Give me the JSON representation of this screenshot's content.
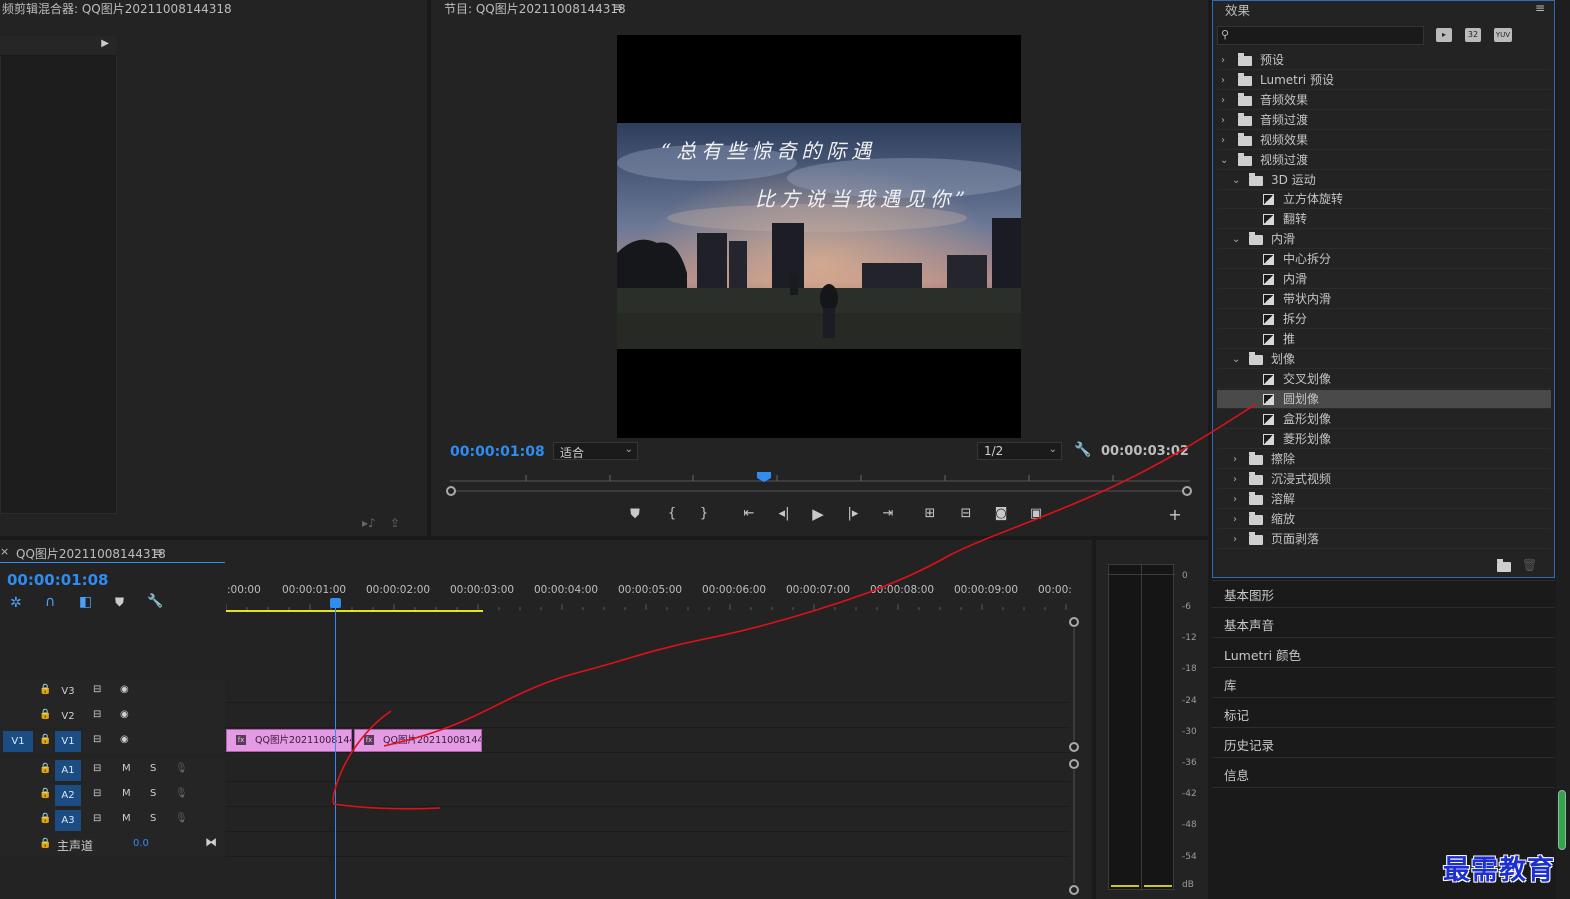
{
  "source_mixer": {
    "title": "频剪辑混合器: QQ图片20211008144318"
  },
  "program": {
    "title": "节目: QQ图片20211008144318",
    "caption_line1": "“总有些惊奇的际遇",
    "caption_line2": "比方说当我遇见你”",
    "current_time": "00:00:01:08",
    "fit_label": "适合",
    "resolution_label": "1/2",
    "duration": "00:00:03:02"
  },
  "timeline": {
    "tab_close": "×",
    "title": "QQ图片20211008144318",
    "current_time": "00:00:01:08",
    "ruler": [
      ":00:00",
      "00:00:01:00",
      "00:00:02:00",
      "00:00:03:00",
      "00:00:04:00",
      "00:00:05:00",
      "00:00:06:00",
      "00:00:07:00",
      "00:00:08:00",
      "00:00:09:00",
      "00:00:"
    ],
    "tracks": {
      "v3": "V3",
      "v2": "V2",
      "v1_src": "V1",
      "v1": "V1",
      "a1": "A1",
      "a2": "A2",
      "a3": "A3",
      "m": "M",
      "s": "S",
      "master_label": "主声道",
      "master_value": "0.0"
    },
    "clips": [
      "QQ图片20211008144",
      "QQ图片20211008144 3"
    ],
    "clip_badge": "fx"
  },
  "meter": {
    "scale": [
      "0",
      "-6",
      "-12",
      "-18",
      "-24",
      "-30",
      "-36",
      "-42",
      "-48",
      "-54",
      "dB"
    ]
  },
  "effects": {
    "title": "效果",
    "search_placeholder": "",
    "badge_32": "32",
    "badge_yuv": "YUV",
    "tree": {
      "presets": "预设",
      "lumetri_presets": "Lumetri 预设",
      "audio_effects": "音频效果",
      "audio_transitions": "音频过渡",
      "video_effects": "视频效果",
      "video_transitions": "视频过渡",
      "motion_3d": "3D 运动",
      "cube_spin": "立方体旋转",
      "flip_over": "翻转",
      "slide": "内滑",
      "center_split": "中心拆分",
      "slide_item": "内滑",
      "band_slide": "带状内滑",
      "split": "拆分",
      "push": "推",
      "iris": "划像",
      "iris_cross": "交叉划像",
      "iris_round": "圆划像",
      "iris_box": "盒形划像",
      "iris_diamond": "菱形划像",
      "wipe": "擦除",
      "immersive": "沉浸式视频",
      "dissolve": "溶解",
      "zoom": "缩放",
      "page_peel": "页面剥落"
    }
  },
  "side_panels": [
    "基本图形",
    "基本声音",
    "Lumetri 颜色",
    "库",
    "标记",
    "历史记录",
    "信息"
  ],
  "watermark": "最需教育",
  "colors": {
    "accent_blue": "#2f8cf0",
    "clip_pink": "#e39be3",
    "annotation_red": "#e0101a",
    "effects_border": "#2e6db3"
  }
}
